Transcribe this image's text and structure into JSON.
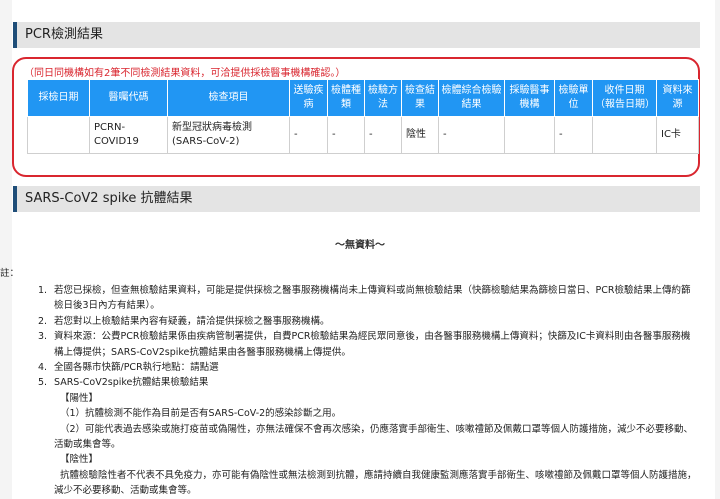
{
  "pcr": {
    "title": "PCR檢測結果",
    "note": "（同日同機構如有2筆不同檢測結果資料，可洽提供採檢醫事機構確認。）",
    "headers": [
      "採檢日期",
      "醫囑代碼",
      "檢查項目",
      "送驗疾病",
      "檢體種類",
      "檢驗方法",
      "檢查結果",
      "檢體綜合檢驗結果",
      "採驗醫事機構",
      "檢驗單位",
      "收件日期（報告日期）",
      "資料來源"
    ],
    "row": {
      "date": "",
      "code": "PCRN-COVID19",
      "item": "新型冠狀病毒檢測(SARS-CoV-2)",
      "disease": "-",
      "specimen": "-",
      "method": "-",
      "result": "陰性",
      "combined": "-",
      "institution": "",
      "unit": "-",
      "received": "",
      "source": "IC卡"
    }
  },
  "spike": {
    "title": "SARS-CoV2 spike 抗體結果",
    "no_data": "～無資料～"
  },
  "notes": {
    "label": "註：",
    "items": [
      "若您已採檢，但查無檢驗結果資料，可能是提供採檢之醫事服務機構尚未上傳資料或尚無檢驗結果（快篩檢驗結果為篩檢日當日、PCR檢驗結果上傳約篩檢日後3日內方有結果）。",
      "若您對以上檢驗結果內容有疑義，請洽提供採檢之醫事服務機構。",
      "資料來源：公費PCR檢驗結果係由疾病管制署提供，自費PCR檢驗結果為經民眾同意後，由各醫事服務機構上傳資料；快篩及IC卡資料則由各醫事服務機構上傳提供；SARS-CoV2spike抗體結果由各醫事服務機構上傳提供。",
      "全國各縣市快篩/PCR執行地點：請點選",
      "SARS-CoV2spike抗體結果檢驗結果"
    ],
    "sub": {
      "pos_label": "【陽性】",
      "pos_1": "（1）抗體檢測不能作為目前是否有SARS-CoV-2的感染診斷之用。",
      "pos_2": "（2）可能代表過去感染或施打疫苗或偽陽性，亦無法確保不會再次感染，仍應落實手部衛生、咳嗽禮節及佩戴口罩等個人防護措施，減少不必要移動、活動或集會等。",
      "neg_label": "【陰性】",
      "neg_1": "抗體檢驗陰性者不代表不具免疫力，亦可能有偽陰性或無法檢測到抗體，應請持續自我健康監測應落實手部衛生、咳嗽禮節及佩戴口罩等個人防護措施，減少不必要移動、活動或集會等。"
    }
  },
  "colors": {
    "header_blue": "#2196f3",
    "highlight_red": "#d9262f",
    "section_bar": "#1f4e79"
  }
}
